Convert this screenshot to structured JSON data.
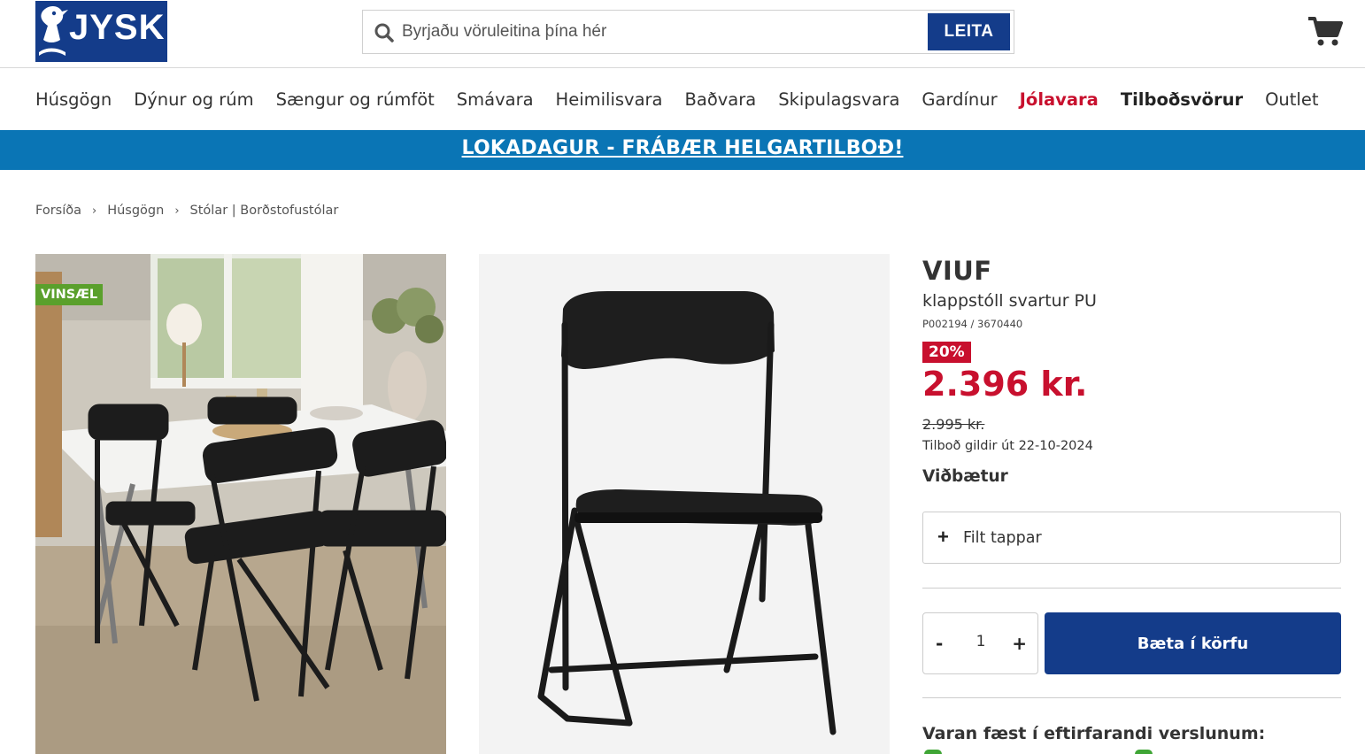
{
  "header": {
    "logo_text": "JYSK",
    "search_placeholder": "Byrjaðu vöruleitina þína hér",
    "search_button": "LEITA",
    "cart_icon": "cart-icon"
  },
  "nav": {
    "items": [
      {
        "label": "Húsgögn"
      },
      {
        "label": "Dýnur og rúm"
      },
      {
        "label": "Sængur og rúmföt"
      },
      {
        "label": "Smávara"
      },
      {
        "label": "Heimilisvara"
      },
      {
        "label": "Baðvara"
      },
      {
        "label": "Skipulagsvara"
      },
      {
        "label": "Gardínur"
      },
      {
        "label": "Jólavara"
      },
      {
        "label": "Tilboðsvörur"
      },
      {
        "label": "Outlet"
      }
    ]
  },
  "banner": {
    "text": "LOKADAGUR - FRÁBÆR HELGARTILBOÐ!"
  },
  "breadcrumb": [
    "Forsíða",
    "Húsgögn",
    "Stólar | Borðstofustólar"
  ],
  "gallery": {
    "badge": "VINSÆL"
  },
  "product": {
    "name": "VIUF",
    "subtitle": "klappstóll svartur PU",
    "sku": "P002194 / 3670440",
    "discount": "20%",
    "price": "2.396 kr.",
    "old_price": "2.995 kr.",
    "valid_until": "Tilboð gildir út 22-10-2024",
    "addons_title": "Viðbætur",
    "addon_label": "Filt tappar",
    "quantity": "1",
    "minus_label": "-",
    "plus_label": "+",
    "add_to_cart": "Bæta í körfu",
    "availability_title": "Varan fæst í eftirfarandi verslunum:"
  },
  "colors": {
    "brand_blue": "#143c8a",
    "banner_blue": "#0a75b5",
    "sale_red": "#c8102e",
    "badge_green": "#5aa02c"
  }
}
